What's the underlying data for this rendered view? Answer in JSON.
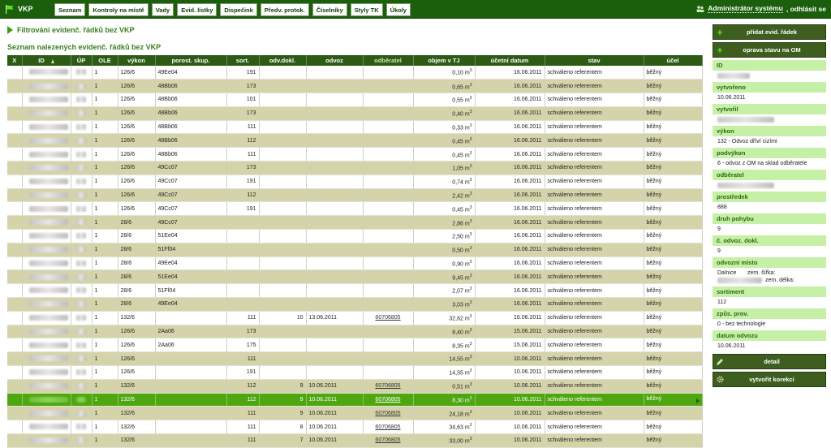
{
  "app": {
    "title": "VKP"
  },
  "nav": [
    "Seznam",
    "Kontroly na místě",
    "Vady",
    "Evid. lístky",
    "Dispečink",
    "Předv. protok.",
    "Číselníky",
    "Styly TK",
    "Úkoly"
  ],
  "user": {
    "name": "Administrátor systému",
    "logout": ", odhlásit se"
  },
  "filter": {
    "title": "Filtrování evidenč. řádků bez VKP"
  },
  "list": {
    "title": "Seznam nalezených evidenč. řádků bez VKP"
  },
  "table": {
    "columns": [
      "X",
      "ID",
      "ÚP",
      "OLE",
      "výkon",
      "porost. skup.",
      "sort.",
      "odv.dokl.",
      "odvoz",
      "odběratel",
      "objem v TJ",
      "účetní datum",
      "stav",
      "účel"
    ],
    "unit": "m",
    "unit_power": "3",
    "rows": [
      {
        "ole": "1",
        "vykon": "126/6",
        "skup": "49Ee04",
        "sort": "191",
        "dokl": "",
        "odvoz": "",
        "odberatel": "",
        "objem": "0,10",
        "datum": "16.06.2011",
        "stav": "schváleno referentem",
        "ucel": "běžný"
      },
      {
        "ole": "1",
        "vykon": "126/6",
        "skup": "48Bb06",
        "sort": "173",
        "dokl": "",
        "odvoz": "",
        "odberatel": "",
        "objem": "0,65",
        "datum": "16.06.2011",
        "stav": "schváleno referentem",
        "ucel": "běžný"
      },
      {
        "ole": "1",
        "vykon": "126/6",
        "skup": "48Bb06",
        "sort": "101",
        "dokl": "",
        "odvoz": "",
        "odberatel": "",
        "objem": "0,55",
        "datum": "16.06.2011",
        "stav": "schváleno referentem",
        "ucel": "běžný"
      },
      {
        "ole": "1",
        "vykon": "126/6",
        "skup": "48Bb06",
        "sort": "173",
        "dokl": "",
        "odvoz": "",
        "odberatel": "",
        "objem": "0,40",
        "datum": "16.06.2011",
        "stav": "schváleno referentem",
        "ucel": "běžný"
      },
      {
        "ole": "1",
        "vykon": "126/6",
        "skup": "48Bb06",
        "sort": "111",
        "dokl": "",
        "odvoz": "",
        "odberatel": "",
        "objem": "0,33",
        "datum": "16.06.2011",
        "stav": "schváleno referentem",
        "ucel": "běžný"
      },
      {
        "ole": "1",
        "vykon": "126/6",
        "skup": "48Bb06",
        "sort": "112",
        "dokl": "",
        "odvoz": "",
        "odberatel": "",
        "objem": "0,45",
        "datum": "16.06.2011",
        "stav": "schváleno referentem",
        "ucel": "běžný"
      },
      {
        "ole": "1",
        "vykon": "126/6",
        "skup": "48Bb06",
        "sort": "111",
        "dokl": "",
        "odvoz": "",
        "odberatel": "",
        "objem": "0,45",
        "datum": "16.06.2011",
        "stav": "schváleno referentem",
        "ucel": "běžný"
      },
      {
        "ole": "1",
        "vykon": "126/6",
        "skup": "49Cc07",
        "sort": "173",
        "dokl": "",
        "odvoz": "",
        "odberatel": "",
        "objem": "1,05",
        "datum": "16.06.2011",
        "stav": "schváleno referentem",
        "ucel": "běžný"
      },
      {
        "ole": "1",
        "vykon": "126/6",
        "skup": "49Cc07",
        "sort": "191",
        "dokl": "",
        "odvoz": "",
        "odberatel": "",
        "objem": "0,74",
        "datum": "16.06.2011",
        "stav": "schváleno referentem",
        "ucel": "běžný"
      },
      {
        "ole": "1",
        "vykon": "126/6",
        "skup": "49Cc07",
        "sort": "112",
        "dokl": "",
        "odvoz": "",
        "odberatel": "",
        "objem": "2,42",
        "datum": "16.06.2011",
        "stav": "schváleno referentem",
        "ucel": "běžný"
      },
      {
        "ole": "1",
        "vykon": "126/6",
        "skup": "49Cc07",
        "sort": "191",
        "dokl": "",
        "odvoz": "",
        "odberatel": "",
        "objem": "0,45",
        "datum": "16.06.2011",
        "stav": "schváleno referentem",
        "ucel": "běžný"
      },
      {
        "ole": "1",
        "vykon": "28/6",
        "skup": "49Cc07",
        "sort": "",
        "dokl": "",
        "odvoz": "",
        "odberatel": "",
        "objem": "2,86",
        "datum": "16.06.2011",
        "stav": "schváleno referentem",
        "ucel": "běžný"
      },
      {
        "ole": "1",
        "vykon": "28/6",
        "skup": "51Ee04",
        "sort": "",
        "dokl": "",
        "odvoz": "",
        "odberatel": "",
        "objem": "2,50",
        "datum": "16.06.2011",
        "stav": "schváleno referentem",
        "ucel": "běžný"
      },
      {
        "ole": "1",
        "vykon": "28/6",
        "skup": "51Ff04",
        "sort": "",
        "dokl": "",
        "odvoz": "",
        "odberatel": "",
        "objem": "0,50",
        "datum": "16.06.2011",
        "stav": "schváleno referentem",
        "ucel": "běžný"
      },
      {
        "ole": "1",
        "vykon": "28/6",
        "skup": "49Ee04",
        "sort": "",
        "dokl": "",
        "odvoz": "",
        "odberatel": "",
        "objem": "0,90",
        "datum": "16.06.2011",
        "stav": "schváleno referentem",
        "ucel": "běžný"
      },
      {
        "ole": "1",
        "vykon": "28/6",
        "skup": "51Ee04",
        "sort": "",
        "dokl": "",
        "odvoz": "",
        "odberatel": "",
        "objem": "9,45",
        "datum": "16.06.2011",
        "stav": "schváleno referentem",
        "ucel": "běžný"
      },
      {
        "ole": "1",
        "vykon": "28/6",
        "skup": "51Ff04",
        "sort": "",
        "dokl": "",
        "odvoz": "",
        "odberatel": "",
        "objem": "2,07",
        "datum": "16.06.2011",
        "stav": "schváleno referentem",
        "ucel": "běžný"
      },
      {
        "ole": "1",
        "vykon": "28/6",
        "skup": "49Ee04",
        "sort": "",
        "dokl": "",
        "odvoz": "",
        "odberatel": "",
        "objem": "3,03",
        "datum": "16.06.2011",
        "stav": "schváleno referentem",
        "ucel": "běžný"
      },
      {
        "ole": "1",
        "vykon": "132/6",
        "skup": "",
        "sort": "111",
        "dokl": "10",
        "odvoz": "13.06.2011",
        "odberatel": "60706805",
        "objem": "32,62",
        "datum": "16.06.2011",
        "stav": "schváleno referentem",
        "ucel": "běžný"
      },
      {
        "ole": "1",
        "vykon": "126/6",
        "skup": "2Aa06",
        "sort": "173",
        "dokl": "",
        "odvoz": "",
        "odberatel": "",
        "objem": "8,40",
        "datum": "15.06.2011",
        "stav": "schváleno referentem",
        "ucel": "běžný"
      },
      {
        "ole": "1",
        "vykon": "126/6",
        "skup": "2Aa06",
        "sort": "175",
        "dokl": "",
        "odvoz": "",
        "odberatel": "",
        "objem": "8,35",
        "datum": "15.06.2011",
        "stav": "schváleno referentem",
        "ucel": "běžný"
      },
      {
        "ole": "1",
        "vykon": "126/6",
        "skup": "",
        "sort": "111",
        "dokl": "",
        "odvoz": "",
        "odberatel": "",
        "objem": "14,55",
        "datum": "10.06.2011",
        "stav": "schváleno referentem",
        "ucel": "běžný"
      },
      {
        "ole": "1",
        "vykon": "126/6",
        "skup": "",
        "sort": "191",
        "dokl": "",
        "odvoz": "",
        "odberatel": "",
        "objem": "14,55",
        "datum": "10.06.2011",
        "stav": "schváleno referentem",
        "ucel": "běžný"
      },
      {
        "ole": "1",
        "vykon": "132/6",
        "skup": "",
        "sort": "112",
        "dokl": "9",
        "odvoz": "10.06.2011",
        "odberatel": "60706805",
        "objem": "0,51",
        "datum": "10.06.2011",
        "stav": "schváleno referentem",
        "ucel": "běžný"
      },
      {
        "ole": "1",
        "vykon": "132/6",
        "skup": "",
        "sort": "112",
        "dokl": "9",
        "odvoz": "10.06.2011",
        "odberatel": "60706805",
        "objem": "8,30",
        "datum": "10.06.2011",
        "stav": "schváleno referentem",
        "ucel": "běžný",
        "selected": true
      },
      {
        "ole": "1",
        "vykon": "132/6",
        "skup": "",
        "sort": "111",
        "dokl": "9",
        "odvoz": "10.06.2011",
        "odberatel": "60706805",
        "objem": "24,18",
        "datum": "10.06.2011",
        "stav": "schváleno referentem",
        "ucel": "běžný"
      },
      {
        "ole": "1",
        "vykon": "132/6",
        "skup": "",
        "sort": "111",
        "dokl": "8",
        "odvoz": "10.06.2011",
        "odberatel": "60706805",
        "objem": "34,63",
        "datum": "10.06.2011",
        "stav": "schváleno referentem",
        "ucel": "běžný"
      },
      {
        "ole": "1",
        "vykon": "132/6",
        "skup": "",
        "sort": "111",
        "dokl": "7",
        "odvoz": "10.06.2011",
        "odberatel": "60706805",
        "objem": "33,00",
        "datum": "10.06.2011",
        "stav": "schváleno referentem",
        "ucel": "běžný"
      }
    ]
  },
  "sidebar": {
    "add_button": "přidat evid. řádek",
    "fix_button": "oprava stavu na OM",
    "fields": [
      {
        "label": "ID",
        "value": ""
      },
      {
        "label": "vytvořeno",
        "value": "10.06.2011"
      },
      {
        "label": "vytvořil",
        "value": ""
      },
      {
        "label": "výkon",
        "value": "132 - Odvoz dříví cizími"
      },
      {
        "label": "podvýkon",
        "value": "6 - odvoz z OM na sklad odběratele"
      },
      {
        "label": "odběratel",
        "value": ""
      },
      {
        "label": "prostředek",
        "value": "888"
      },
      {
        "label": "druh pohybu",
        "value": "9"
      },
      {
        "label": "č. odvoz. dokl.",
        "value": "9"
      },
      {
        "label": "odvozní místo",
        "value": "Dalnice       zem. šířka:\n                    zem. délka:"
      },
      {
        "label": "sortiment",
        "value": "112"
      },
      {
        "label": "způs. prov.",
        "value": "0 - bez technologie"
      },
      {
        "label": "datum odvozu",
        "value": "10.06.2011"
      }
    ],
    "detail_button": "detail",
    "correction_button": "vytvořit korekci"
  },
  "colors": {
    "topbar": "#1b5e0c",
    "header": "#2d5a14",
    "row_alt": "#d5d3a9",
    "selected": "#4ea610",
    "field_label": "#c6f0a6"
  }
}
